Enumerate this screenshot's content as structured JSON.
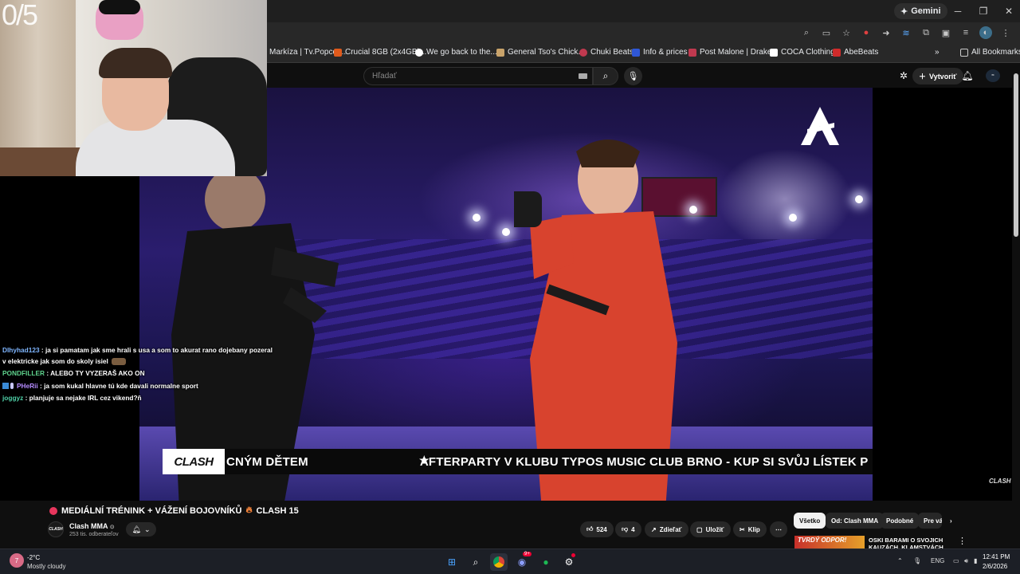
{
  "browser": {
    "gemini_label": "Gemini",
    "bookmarks": [
      {
        "label": "Markíza | Tv.Popcor...",
        "color": "#ffffff"
      },
      {
        "label": "Crucial 8GB (2x4GB)...",
        "color": "#e05a1c"
      },
      {
        "label": "We go back to the...",
        "color": "#ffffff"
      },
      {
        "label": "General Tso's Chick...",
        "color": "#c9a36a"
      },
      {
        "label": "Chuki Beats",
        "color": "#c0394f"
      },
      {
        "label": "Info & prices",
        "color": "#2f57d6"
      },
      {
        "label": "Post Malone | Drake...",
        "color": "#c0394f"
      },
      {
        "label": "COCA Clothing",
        "color": "#ffffff"
      },
      {
        "label": "AbeBeats",
        "color": "#d02b2b"
      }
    ],
    "all_bookmarks_label": "All Bookmarks"
  },
  "youtube": {
    "search_placeholder": "Hľadať",
    "create_label": "Vytvoriť"
  },
  "webcam": {
    "overlay_number": "0/5"
  },
  "video": {
    "ticker_logo": "CLASH",
    "ticker_text_left": "CNÝM DĚTEM",
    "ticker_text_right": "AFTERPARTY V KLUBU TYPOS MUSIC CLUB BRNO - KUP SI SVŮJ LÍSTEK P",
    "corner_logo": "CLASH"
  },
  "chat": [
    {
      "user": "Dlhyhad123",
      "color": "#7fb6ff",
      "text": "ja si pamatam jak sme hrali s usa a som to akurat rano dojebany pozeral v elektricke jak som do skoly isiel"
    },
    {
      "user": "PONDFILLER",
      "color": "#5fd38d",
      "text": "ALEBO TY VYZERAŠ AKO ON"
    },
    {
      "user": "PHeRii",
      "color": "#b58bff",
      "text": "ja som kukal hlavne tú kde davali normalne sport"
    },
    {
      "user": "joggyz",
      "color": "#4fd1a8",
      "text": "planjuje sa nejake IRL cez vikend?ň"
    }
  ],
  "video_info": {
    "title": "MEDIÁLNÍ TRÉNINK + VÁŽENÍ BOJOVNÍKŮ",
    "title_suffix": "CLASH 15",
    "channel_name": "Clash MMA",
    "channel_subs": "253 tis. odberateľov",
    "likes": "524",
    "dislikes": "4",
    "share_label": "Zdieľať",
    "save_label": "Uložiť",
    "clip_label": "Klip"
  },
  "chips": [
    "Všetko",
    "Od: Clash MMA",
    "Podobné",
    "Pre vás"
  ],
  "recommended": {
    "thumb_text": "TVRDÝ ODPOR!",
    "title": "OSKI BARAMI O SVOJICH KAUZÁCH, KLAMSTVÁCH"
  },
  "taskbar": {
    "weather_temp": "-2°C",
    "weather_desc": "Mostly cloudy",
    "weather_badge": "7",
    "lang": "ENG",
    "time": "12:41 PM",
    "date": "2/6/2026",
    "discord_badge": "9+"
  }
}
